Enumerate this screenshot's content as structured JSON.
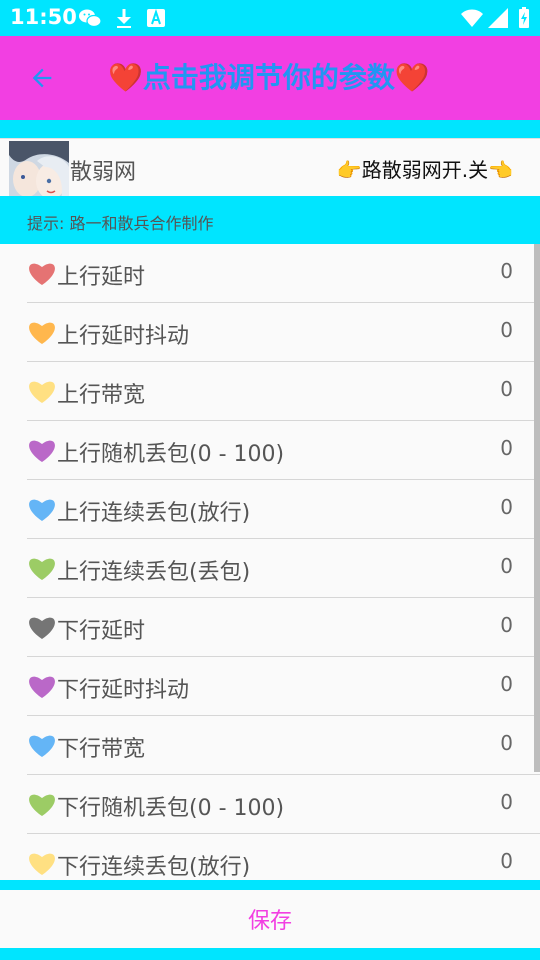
{
  "status_bar": {
    "time": "11:50",
    "icons": [
      "wechat-icon",
      "download-icon",
      "font-icon",
      "wifi-icon",
      "signal-icon",
      "battery-icon"
    ]
  },
  "app_bar": {
    "title": "❤️点击我调节你的参数❤️",
    "back_icon": "arrow-back-icon",
    "background": "#f23fe2",
    "title_color": "#2196f3"
  },
  "switch_row": {
    "label": "散弱网",
    "toggle_label": "👉路散弱网开.关👈"
  },
  "hint": {
    "text": "提示: 路一和散兵合作制作"
  },
  "params": [
    {
      "label": "上行延时",
      "value": "0",
      "heart_color": "#e57373"
    },
    {
      "label": "上行延时抖动",
      "value": "0",
      "heart_color": "#ffb74d"
    },
    {
      "label": "上行带宽",
      "value": "0",
      "heart_color": "#ffe082"
    },
    {
      "label": "上行随机丢包(0 - 100)",
      "value": "0",
      "heart_color": "#ba68c8"
    },
    {
      "label": "上行连续丢包(放行)",
      "value": "0",
      "heart_color": "#64b5f6"
    },
    {
      "label": "上行连续丢包(丢包)",
      "value": "0",
      "heart_color": "#9ccc65"
    },
    {
      "label": "下行延时",
      "value": "0",
      "heart_color": "#757575"
    },
    {
      "label": "下行延时抖动",
      "value": "0",
      "heart_color": "#ba68c8"
    },
    {
      "label": "下行带宽",
      "value": "0",
      "heart_color": "#64b5f6"
    },
    {
      "label": "下行随机丢包(0 - 100)",
      "value": "0",
      "heart_color": "#9ccc65"
    },
    {
      "label": "下行连续丢包(放行)",
      "value": "0",
      "heart_color": "#ffe082"
    }
  ],
  "save_button": {
    "label": "保存"
  },
  "colors": {
    "accent_cyan": "#00e5ff",
    "accent_magenta": "#f23fe2"
  }
}
